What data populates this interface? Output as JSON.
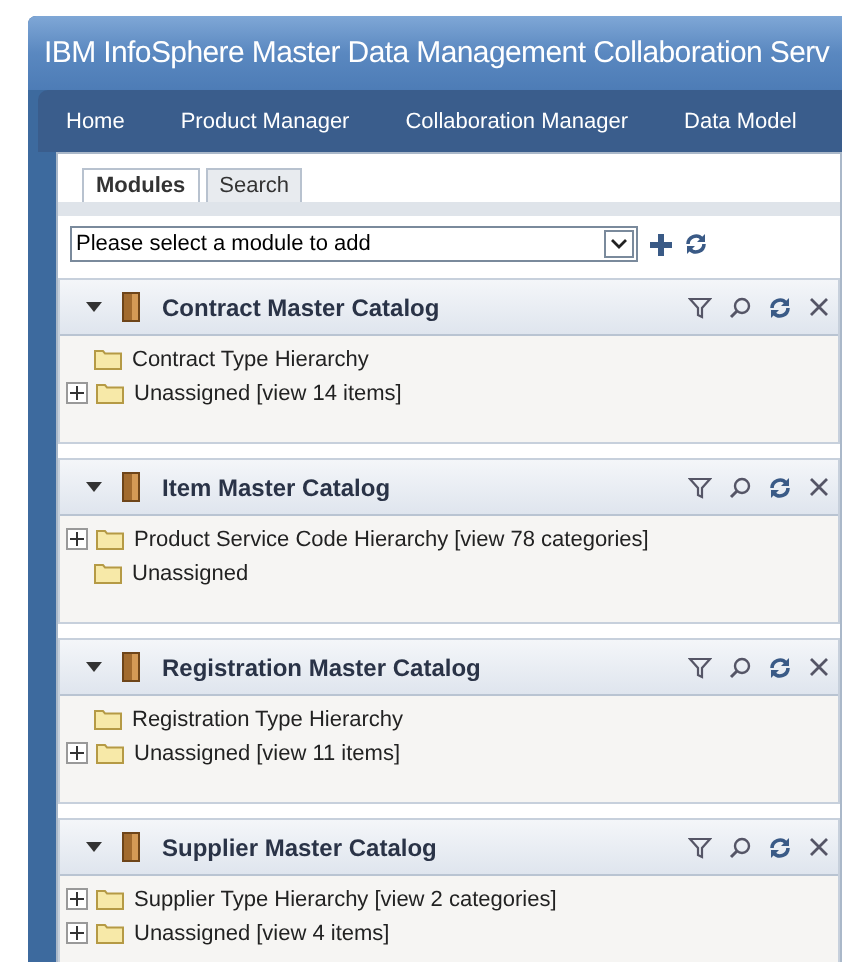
{
  "window": {
    "title": "IBM InfoSphere Master Data Management Collaboration Serv"
  },
  "nav": [
    {
      "label": "Home"
    },
    {
      "label": "Product Manager"
    },
    {
      "label": "Collaboration Manager"
    },
    {
      "label": "Data Model"
    }
  ],
  "tabs": [
    {
      "label": "Modules",
      "selected": true
    },
    {
      "label": "Search",
      "selected": false
    }
  ],
  "module_select": {
    "value": "Please select a module to add"
  },
  "catalogs": [
    {
      "title": "Contract Master Catalog",
      "expanded": true,
      "items": [
        {
          "name": "Contract Type Hierarchy",
          "expandable": false
        },
        {
          "name": "Unassigned",
          "link": "[view 14 items]",
          "expandable": true
        }
      ]
    },
    {
      "title": "Item Master Catalog",
      "expanded": true,
      "items": [
        {
          "name": "Product Service Code Hierarchy",
          "link": "[view 78 categories]",
          "expandable": true
        },
        {
          "name": "Unassigned",
          "expandable": false
        }
      ]
    },
    {
      "title": "Registration Master Catalog",
      "expanded": true,
      "items": [
        {
          "name": "Registration Type Hierarchy",
          "expandable": false
        },
        {
          "name": "Unassigned",
          "link": "[view 11 items]",
          "expandable": true
        }
      ]
    },
    {
      "title": "Supplier Master Catalog",
      "expanded": true,
      "items": [
        {
          "name": "Supplier Type Hierarchy",
          "link": "[view 2 categories]",
          "expandable": true
        },
        {
          "name": "Unassigned",
          "link": "[view 4 items]",
          "expandable": true
        }
      ]
    }
  ]
}
